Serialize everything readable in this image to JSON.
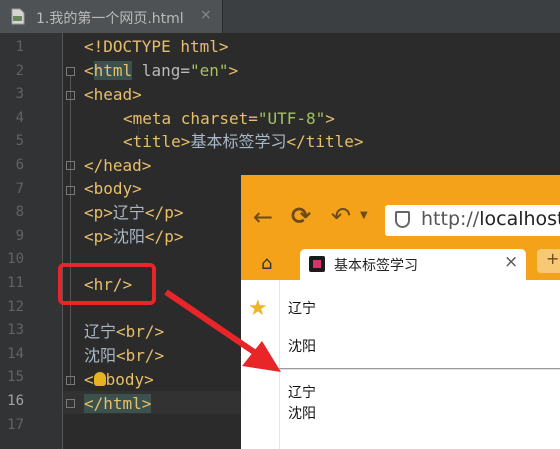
{
  "editor": {
    "tab_title": "1.我的第一个网页.html",
    "tab_close": "×",
    "current_line": 16,
    "line_numbers": [
      "1",
      "2",
      "3",
      "4",
      "5",
      "6",
      "7",
      "8",
      "9",
      "10",
      "11",
      "12",
      "13",
      "14",
      "15",
      "16",
      "17"
    ],
    "lines": {
      "l1_a": "<!DOCTYPE html>",
      "l2_open": "<",
      "l2_tag": "html",
      "l2_attr": " lang=",
      "l2_val": "\"en\"",
      "l2_close": ">",
      "l3": "<head>",
      "l4_a": "<meta charset=",
      "l4_val": "\"UTF-8\"",
      "l4_b": ">",
      "l5_a": "<title>",
      "l5_text": "基本标签学习",
      "l5_b": "</title>",
      "l6": "</head>",
      "l7": "<body>",
      "l8_a": "<p>",
      "l8_text": "辽宁",
      "l8_b": "</p>",
      "l9_a": "<p>",
      "l9_text": "沈阳",
      "l9_b": "</p>",
      "l11": "<hr/>",
      "l13_text": "辽宁",
      "l13_tag": "<br/>",
      "l14_text": "沈阳",
      "l14_tag": "<br/>",
      "l15_a": "<",
      "l15_b": "body>",
      "l16": "</html>"
    }
  },
  "browser": {
    "url_prefix": "http://",
    "url_host": "localhost:",
    "tab_title": "基本标签学习",
    "tab_close": "×",
    "new_tab": "+",
    "page": {
      "p1": "辽宁",
      "p2": "沈阳",
      "br1": "辽宁",
      "br2": "沈阳"
    }
  },
  "icons": [
    "file-html-icon",
    "back-arrow-icon",
    "reload-icon",
    "undo-icon",
    "dropdown-icon",
    "shield-icon",
    "home-icon",
    "favicon-icon",
    "star-icon",
    "lightbulb-icon"
  ],
  "colors": {
    "annotation": "#e8262a",
    "browser_toolbar": "#f4a21a",
    "tag": "#e8bf6a",
    "string": "#a5c25c"
  }
}
